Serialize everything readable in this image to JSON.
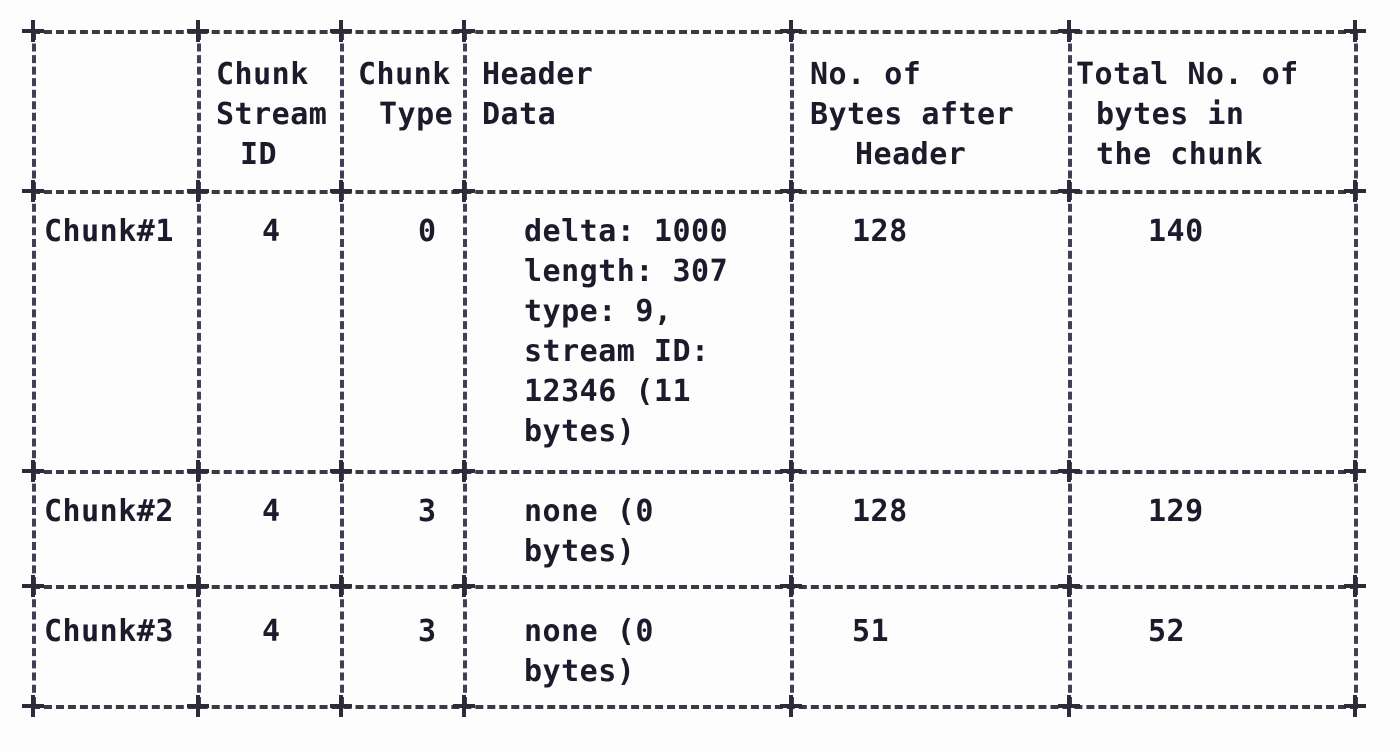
{
  "table": {
    "type": "ascii-art-table",
    "border_style": "+---+ dashed",
    "text_color": "#1b1b2b",
    "background_color": "#fdfdfd",
    "columns": [
      {
        "key": "chunk",
        "header_lines": [
          "",
          "",
          ""
        ]
      },
      {
        "key": "stream_id",
        "header_lines": [
          "Chunk",
          "Stream",
          "ID"
        ]
      },
      {
        "key": "chunk_type",
        "header_lines": [
          "Chunk",
          "Type",
          ""
        ]
      },
      {
        "key": "header_data",
        "header_lines": [
          "Header",
          "Data",
          ""
        ]
      },
      {
        "key": "bytes_after",
        "header_lines": [
          "No. of",
          "Bytes after",
          "Header"
        ]
      },
      {
        "key": "total_bytes",
        "header_lines": [
          "Total No. of",
          "bytes in",
          "the chunk"
        ]
      }
    ],
    "rows": [
      {
        "chunk": "Chunk#1",
        "stream_id": "4",
        "chunk_type": "0",
        "header_data_lines": [
          "delta: 1000",
          "length: 307",
          "type: 9,",
          "stream ID:",
          "12346 (11",
          "bytes)"
        ],
        "bytes_after": "128",
        "total_bytes": "140"
      },
      {
        "chunk": "Chunk#2",
        "stream_id": "4",
        "chunk_type": "3",
        "header_data_lines": [
          "none (0",
          "bytes)"
        ],
        "bytes_after": "128",
        "total_bytes": "129"
      },
      {
        "chunk": "Chunk#3",
        "stream_id": "4",
        "chunk_type": "3",
        "header_data_lines": [
          "none (0",
          "bytes)"
        ],
        "bytes_after": "51",
        "total_bytes": "52"
      }
    ]
  }
}
